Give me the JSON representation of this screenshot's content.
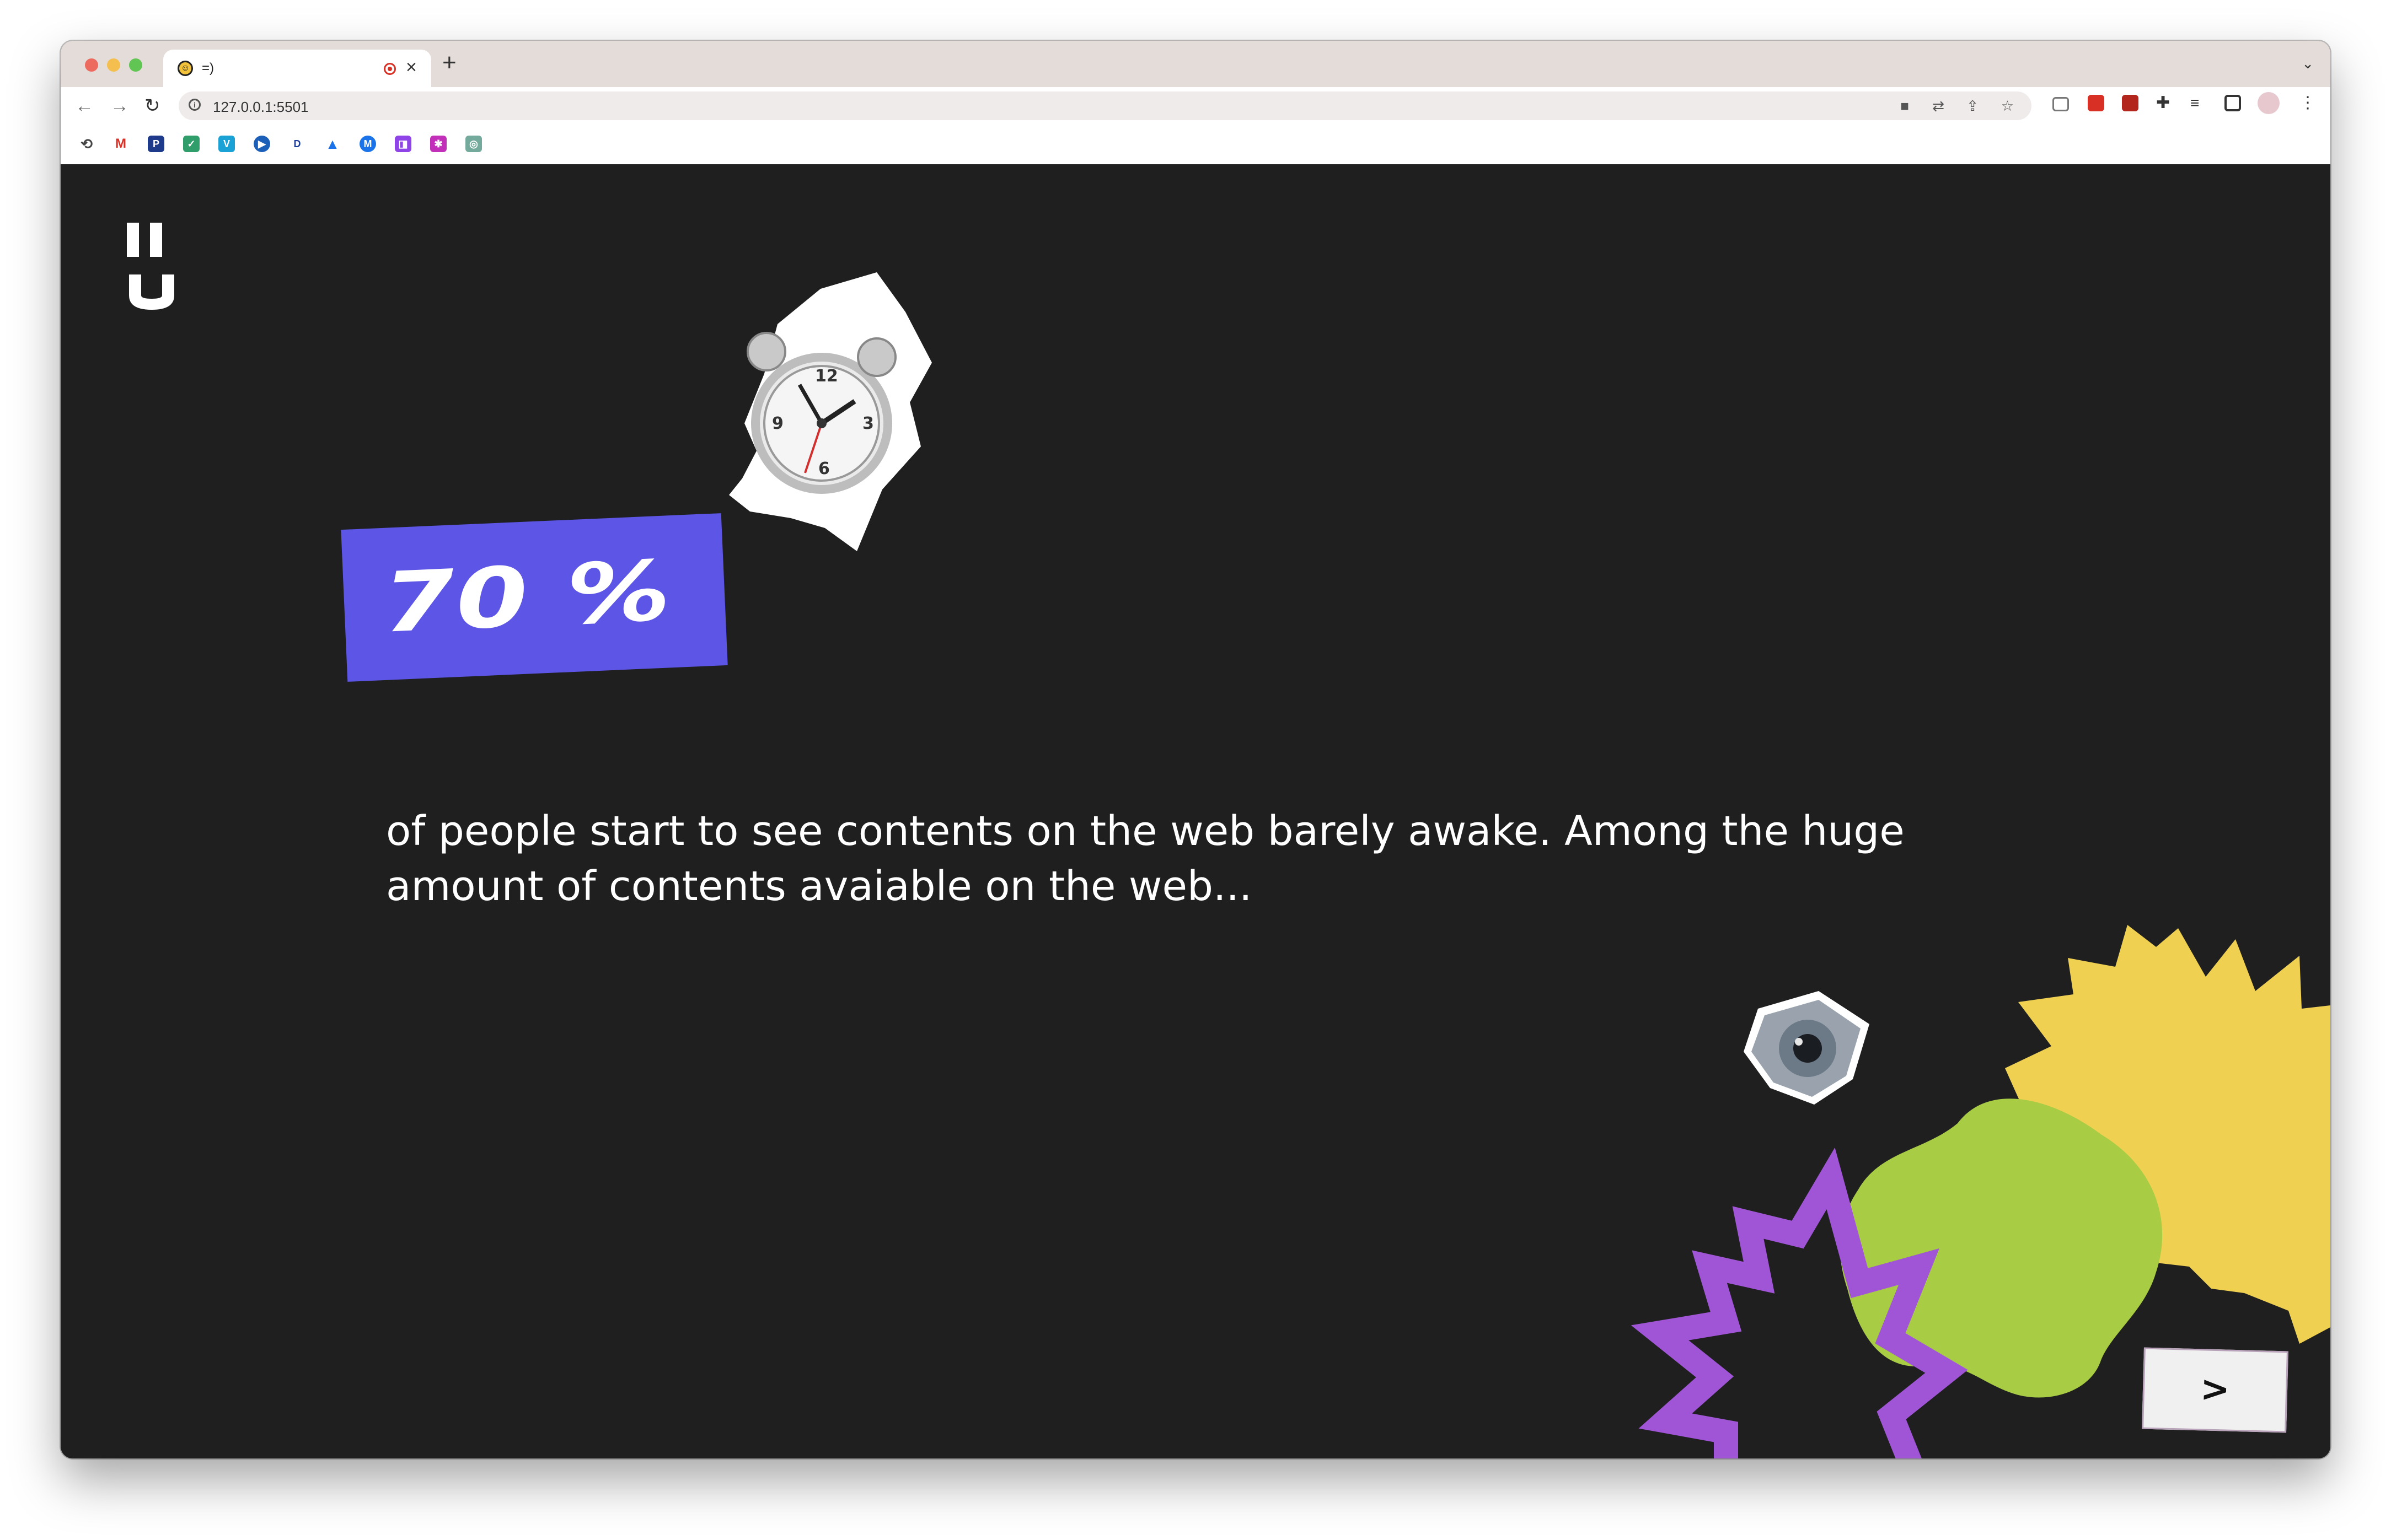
{
  "browser": {
    "tab_title": "=)",
    "tab_favicon": "smiley-icon",
    "tab_close": "×",
    "new_tab": "+",
    "tab_menu": "⌄",
    "url": "127.0.0.1:5501",
    "nav": {
      "back": "←",
      "forward": "→",
      "reload": "↻"
    },
    "omnibox_icons": [
      "camera-off-icon",
      "translate-icon",
      "share-icon",
      "star-icon"
    ],
    "extensions": [
      "cast-icon",
      "youtube-icon",
      "pdf-icon",
      "puzzle-icon",
      "reading-list-icon",
      "sidebar-icon",
      "profile-avatar",
      "menu-icon"
    ],
    "bookmarks": [
      "history-icon",
      "gmail-icon",
      "p-icon",
      "check-icon",
      "v-icon",
      "play-icon",
      "disney-icon",
      "drive-icon",
      "m-icon",
      "twitch-icon",
      "flower-icon",
      "chatgpt-icon"
    ]
  },
  "page": {
    "logo": "logo",
    "stat": "70 %",
    "text": "of people start to see contents on the web barely awake. Among the huge amount of contents avaiable on the web...",
    "next_label": ">",
    "colors": {
      "background": "#1f1f1f",
      "stat_box": "#5d55e6",
      "yellow": "#efd051",
      "green": "#a8cc44",
      "purple": "#9f55d6"
    },
    "decorations": [
      "alarm-clock-cutout",
      "eye-cutout",
      "yellow-starburst",
      "green-blob",
      "purple-starburst"
    ]
  }
}
